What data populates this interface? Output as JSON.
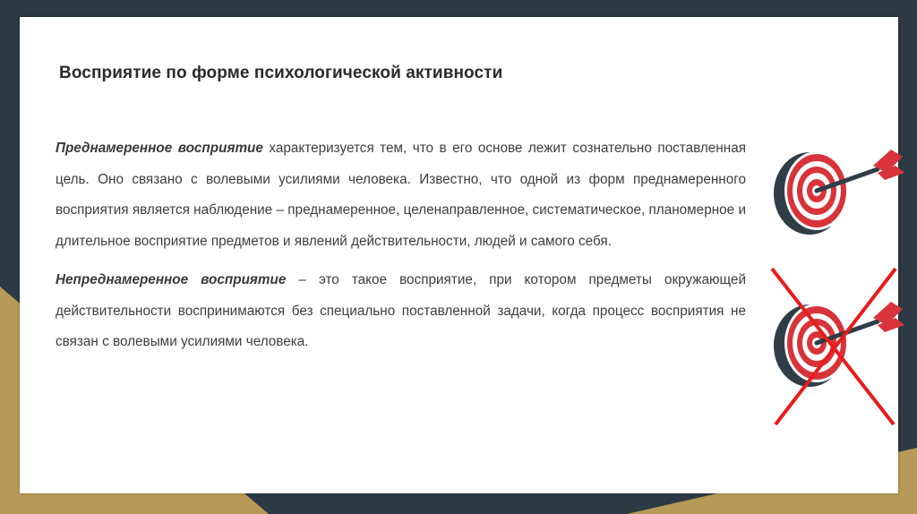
{
  "title": "Восприятие по форме психологической активности",
  "paragraph1": {
    "term": "Преднамеренное восприятие",
    "text": " характеризуется тем, что в его основе лежит сознательно поставленная цель. Оно связано с волевыми усилиями человека. Известно, что одной из форм преднамеренного восприятия является наблюдение – преднамеренное, целенаправленное, систематическое, планомерное и длительное восприятие предметов и явлений действительности, людей и самого себя."
  },
  "paragraph2": {
    "term": "Непреднамеренное восприятие",
    "text": " – это такое восприятие, при котором предметы окружающей действительности воспринимаются без специально поставленной задачи, когда процесс восприятия не связан с волевыми усилиями человека."
  },
  "icons": {
    "target_hit": "target-with-arrow-icon",
    "target_crossed": "crossed-out-target-icon"
  },
  "colors": {
    "background_dark": "#2b3a44",
    "background_gold": "#b89a58",
    "target_red": "#d9333a",
    "target_dark": "#2f3d47",
    "cross_red": "#e81c1c"
  }
}
